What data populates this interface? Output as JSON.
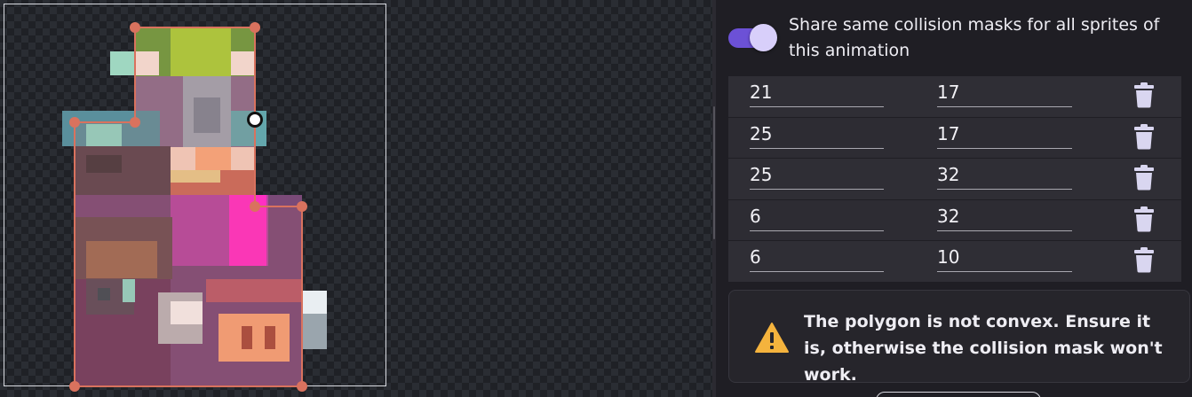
{
  "collision": {
    "share_label": "Share same collision masks for all sprites of this animation",
    "share_enabled": true,
    "rows": [
      {
        "x": "21",
        "y": "17"
      },
      {
        "x": "25",
        "y": "17"
      },
      {
        "x": "25",
        "y": "32"
      },
      {
        "x": "6",
        "y": "32"
      },
      {
        "x": "6",
        "y": "10"
      }
    ]
  },
  "warning": {
    "icon": "warning-triangle-icon",
    "message": "The polygon is not convex. Ensure it is, otherwise the collision mask won't work."
  },
  "colors": {
    "accent": "#6c51d6",
    "mask_outline": "#d9725e",
    "warning": "#f4b33d"
  }
}
